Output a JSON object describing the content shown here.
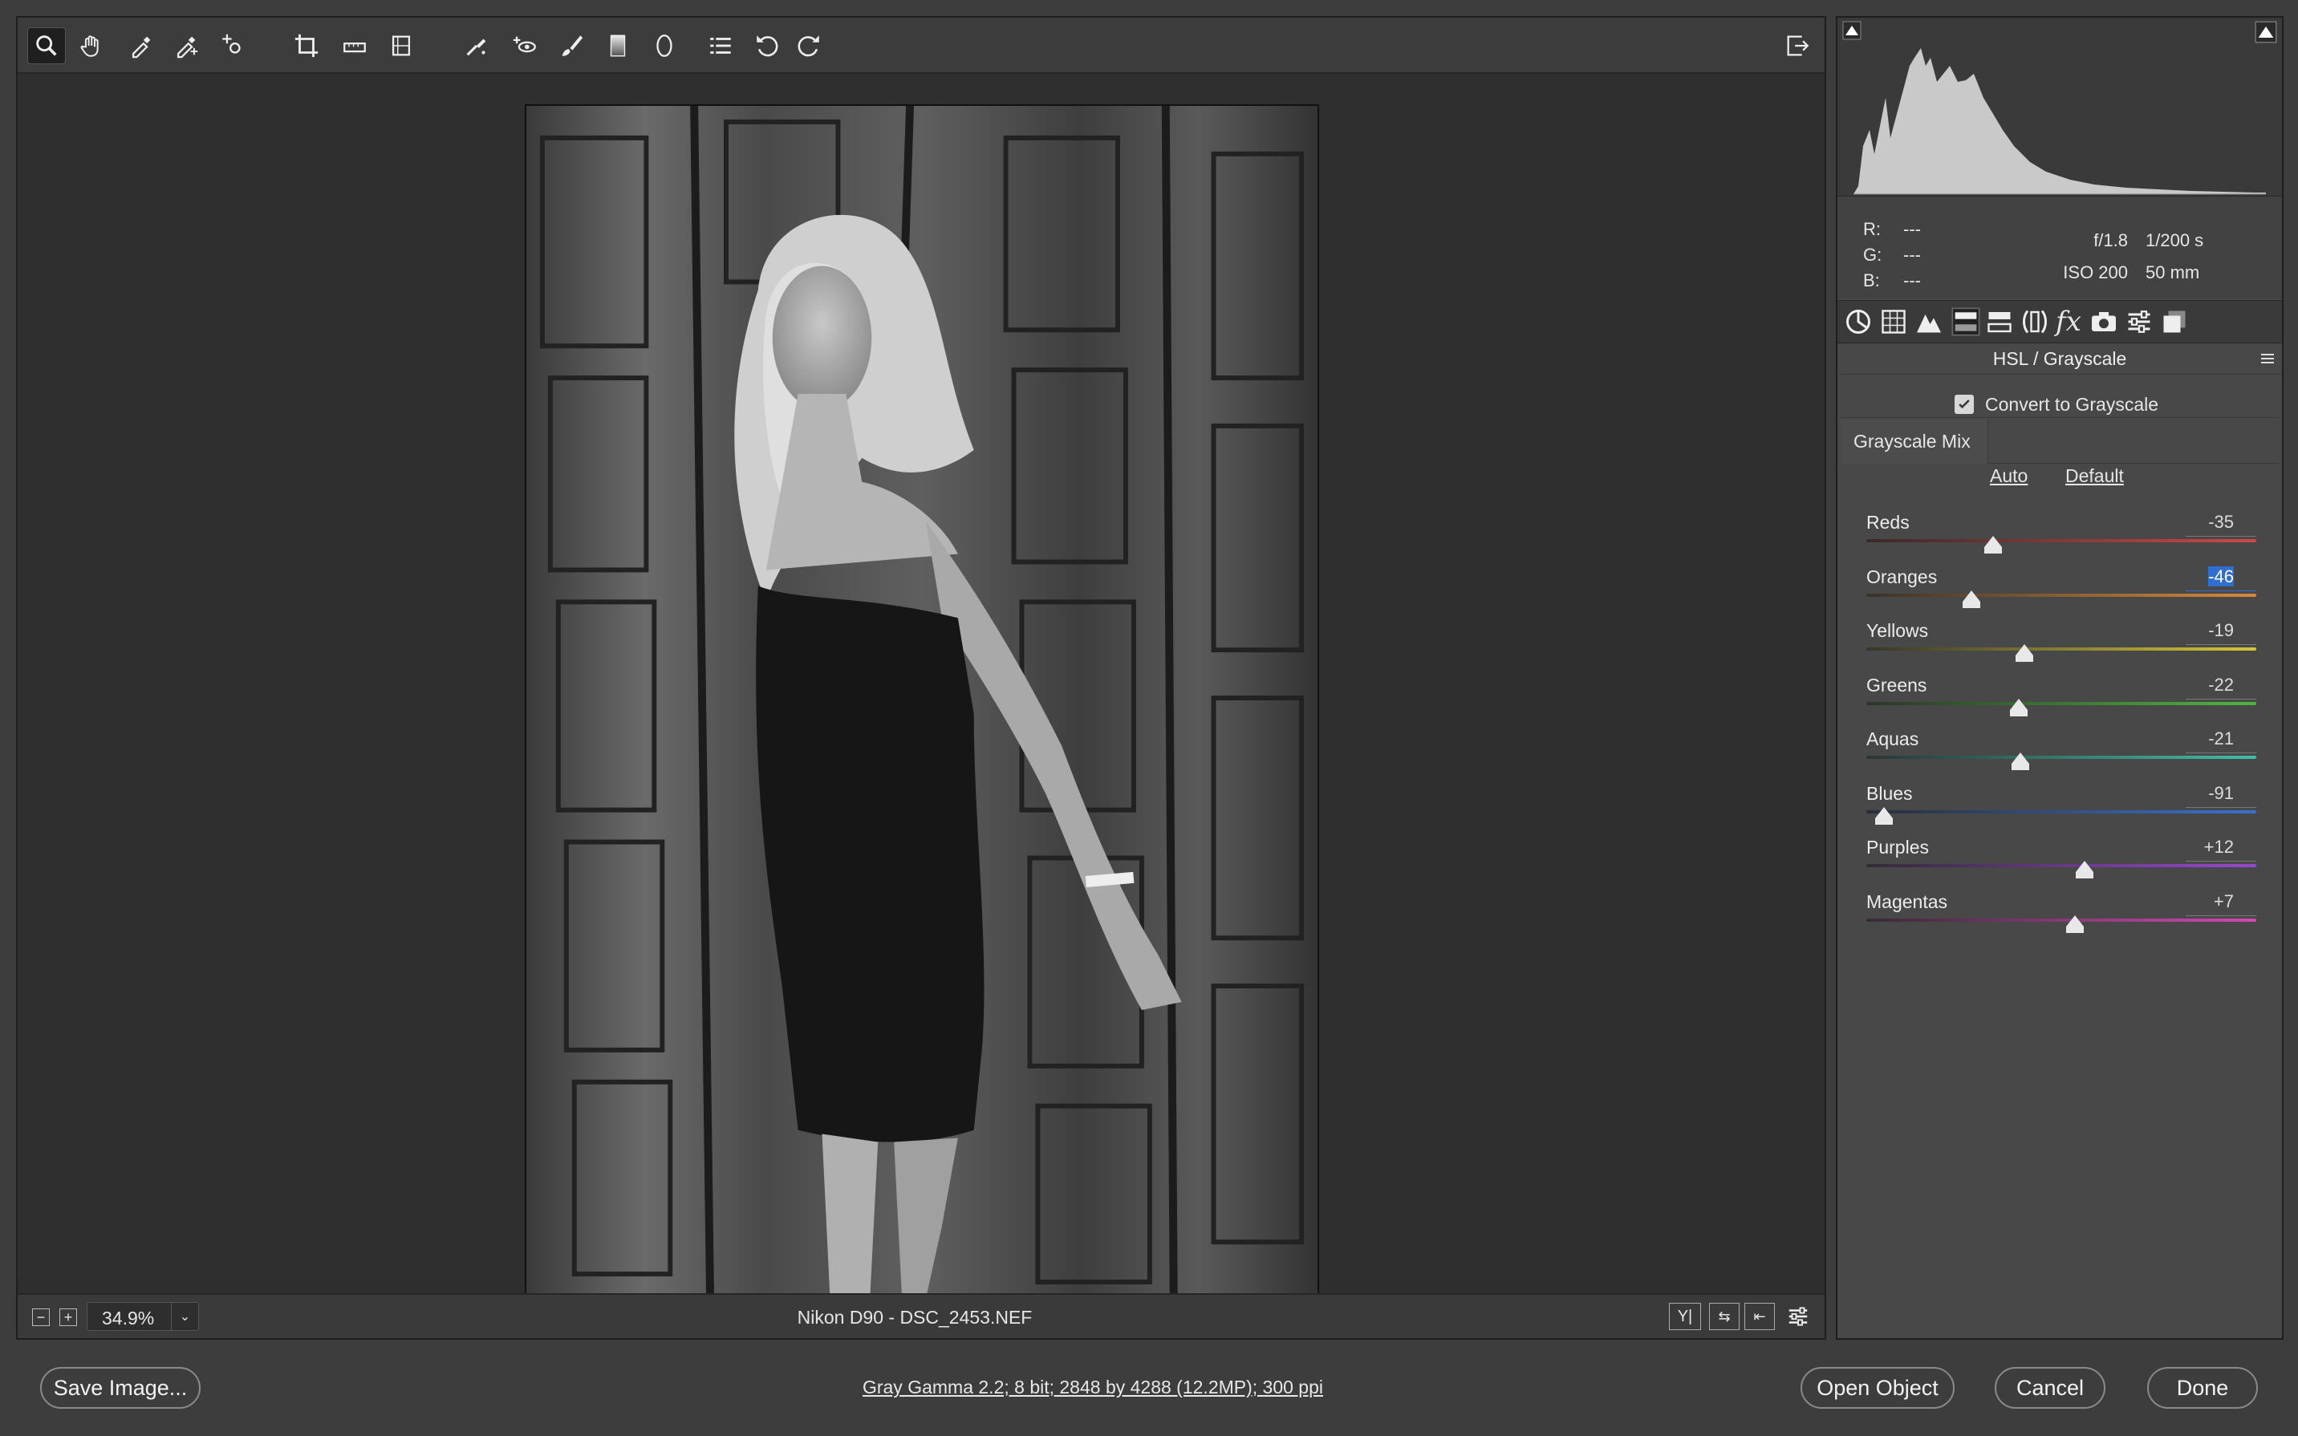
{
  "toolbar": {
    "tools": [
      "zoom-tool",
      "hand-tool",
      "white-balance-tool",
      "color-sampler-tool",
      "targeted-adjustment-tool",
      "crop-tool",
      "straighten-tool",
      "transform-tool",
      "spot-removal-tool",
      "red-eye-tool",
      "adjustment-brush-tool",
      "graduated-filter-tool",
      "radial-filter-tool",
      "preferences-tool",
      "rotate-ccw-tool",
      "rotate-cw-tool"
    ]
  },
  "photo": {
    "description_icon": "photo-preview"
  },
  "statusbar": {
    "zoom": "34.9%",
    "filename": "Nikon D90  -  DSC_2453.NEF"
  },
  "histogram": {
    "rgb": {
      "r_label": "R:",
      "r_value": "---",
      "g_label": "G:",
      "g_value": "---",
      "b_label": "B:",
      "b_value": "---"
    },
    "aperture": "f/1.8",
    "shutter": "1/200 s",
    "iso": "ISO 200",
    "focal": "50 mm"
  },
  "panel": {
    "title": "HSL / Grayscale",
    "convert_label": "Convert to Grayscale",
    "convert_checked": true,
    "tab_label": "Grayscale Mix",
    "auto_label": "Auto",
    "default_label": "Default",
    "sliders": [
      {
        "label": "Reds",
        "value": "-35",
        "num": -35,
        "gradient": "linear-gradient(to right,#3a2a2a,#d04848)"
      },
      {
        "label": "Oranges",
        "value": "-46",
        "num": -46,
        "gradient": "linear-gradient(to right,#3a322a,#d88a3a)",
        "selected": true
      },
      {
        "label": "Yellows",
        "value": "-19",
        "num": -19,
        "gradient": "linear-gradient(to right,#36362a,#d6c83a)"
      },
      {
        "label": "Greens",
        "value": "-22",
        "num": -22,
        "gradient": "linear-gradient(to right,#2c362a,#4fb640)"
      },
      {
        "label": "Aquas",
        "value": "-21",
        "num": -21,
        "gradient": "linear-gradient(to right,#2a3634,#3fbfa8)"
      },
      {
        "label": "Blues",
        "value": "-91",
        "num": -91,
        "gradient": "linear-gradient(to right,#2a2e38,#3a72d0)"
      },
      {
        "label": "Purples",
        "value": "+12",
        "num": 12,
        "gradient": "linear-gradient(to right,#322a38,#9a48d0)"
      },
      {
        "label": "Magentas",
        "value": "+7",
        "num": 7,
        "gradient": "linear-gradient(to right,#382a36,#d448b6)"
      }
    ]
  },
  "bottom": {
    "save_label": "Save Image...",
    "workflow_text": "Gray Gamma 2.2; 8 bit; 2848 by 4288 (12.2MP); 300 ppi",
    "open_label": "Open Object",
    "cancel_label": "Cancel",
    "done_label": "Done"
  },
  "colors": {
    "accent": "#2f6fd1",
    "panel_bg": "#484848",
    "workspace_bg": "#2f2f2f"
  }
}
